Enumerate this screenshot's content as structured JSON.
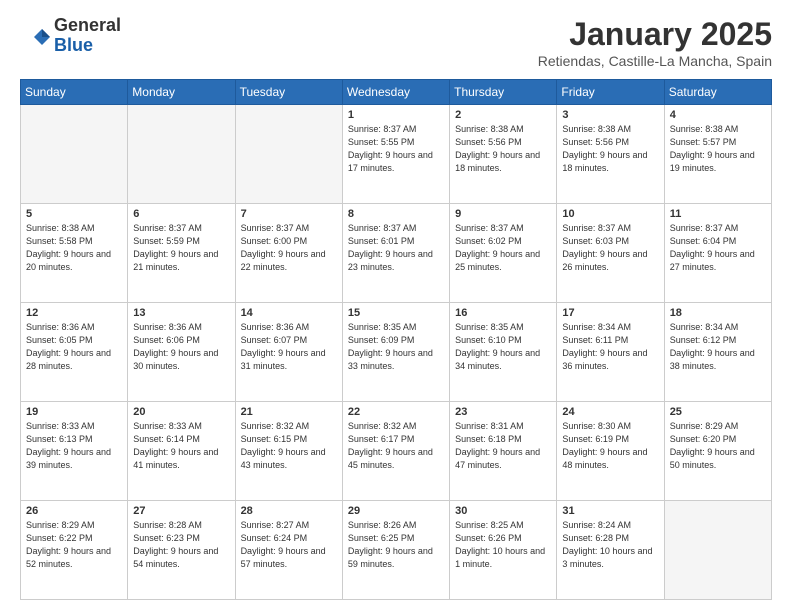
{
  "logo": {
    "general": "General",
    "blue": "Blue"
  },
  "header": {
    "month": "January 2025",
    "location": "Retiendas, Castille-La Mancha, Spain"
  },
  "weekdays": [
    "Sunday",
    "Monday",
    "Tuesday",
    "Wednesday",
    "Thursday",
    "Friday",
    "Saturday"
  ],
  "weeks": [
    [
      {
        "day": "",
        "empty": true
      },
      {
        "day": "",
        "empty": true
      },
      {
        "day": "",
        "empty": true
      },
      {
        "day": "1",
        "sunrise": "8:37 AM",
        "sunset": "5:55 PM",
        "daylight": "9 hours and 17 minutes."
      },
      {
        "day": "2",
        "sunrise": "8:38 AM",
        "sunset": "5:56 PM",
        "daylight": "9 hours and 18 minutes."
      },
      {
        "day": "3",
        "sunrise": "8:38 AM",
        "sunset": "5:56 PM",
        "daylight": "9 hours and 18 minutes."
      },
      {
        "day": "4",
        "sunrise": "8:38 AM",
        "sunset": "5:57 PM",
        "daylight": "9 hours and 19 minutes."
      }
    ],
    [
      {
        "day": "5",
        "sunrise": "8:38 AM",
        "sunset": "5:58 PM",
        "daylight": "9 hours and 20 minutes."
      },
      {
        "day": "6",
        "sunrise": "8:37 AM",
        "sunset": "5:59 PM",
        "daylight": "9 hours and 21 minutes."
      },
      {
        "day": "7",
        "sunrise": "8:37 AM",
        "sunset": "6:00 PM",
        "daylight": "9 hours and 22 minutes."
      },
      {
        "day": "8",
        "sunrise": "8:37 AM",
        "sunset": "6:01 PM",
        "daylight": "9 hours and 23 minutes."
      },
      {
        "day": "9",
        "sunrise": "8:37 AM",
        "sunset": "6:02 PM",
        "daylight": "9 hours and 25 minutes."
      },
      {
        "day": "10",
        "sunrise": "8:37 AM",
        "sunset": "6:03 PM",
        "daylight": "9 hours and 26 minutes."
      },
      {
        "day": "11",
        "sunrise": "8:37 AM",
        "sunset": "6:04 PM",
        "daylight": "9 hours and 27 minutes."
      }
    ],
    [
      {
        "day": "12",
        "sunrise": "8:36 AM",
        "sunset": "6:05 PM",
        "daylight": "9 hours and 28 minutes."
      },
      {
        "day": "13",
        "sunrise": "8:36 AM",
        "sunset": "6:06 PM",
        "daylight": "9 hours and 30 minutes."
      },
      {
        "day": "14",
        "sunrise": "8:36 AM",
        "sunset": "6:07 PM",
        "daylight": "9 hours and 31 minutes."
      },
      {
        "day": "15",
        "sunrise": "8:35 AM",
        "sunset": "6:09 PM",
        "daylight": "9 hours and 33 minutes."
      },
      {
        "day": "16",
        "sunrise": "8:35 AM",
        "sunset": "6:10 PM",
        "daylight": "9 hours and 34 minutes."
      },
      {
        "day": "17",
        "sunrise": "8:34 AM",
        "sunset": "6:11 PM",
        "daylight": "9 hours and 36 minutes."
      },
      {
        "day": "18",
        "sunrise": "8:34 AM",
        "sunset": "6:12 PM",
        "daylight": "9 hours and 38 minutes."
      }
    ],
    [
      {
        "day": "19",
        "sunrise": "8:33 AM",
        "sunset": "6:13 PM",
        "daylight": "9 hours and 39 minutes."
      },
      {
        "day": "20",
        "sunrise": "8:33 AM",
        "sunset": "6:14 PM",
        "daylight": "9 hours and 41 minutes."
      },
      {
        "day": "21",
        "sunrise": "8:32 AM",
        "sunset": "6:15 PM",
        "daylight": "9 hours and 43 minutes."
      },
      {
        "day": "22",
        "sunrise": "8:32 AM",
        "sunset": "6:17 PM",
        "daylight": "9 hours and 45 minutes."
      },
      {
        "day": "23",
        "sunrise": "8:31 AM",
        "sunset": "6:18 PM",
        "daylight": "9 hours and 47 minutes."
      },
      {
        "day": "24",
        "sunrise": "8:30 AM",
        "sunset": "6:19 PM",
        "daylight": "9 hours and 48 minutes."
      },
      {
        "day": "25",
        "sunrise": "8:29 AM",
        "sunset": "6:20 PM",
        "daylight": "9 hours and 50 minutes."
      }
    ],
    [
      {
        "day": "26",
        "sunrise": "8:29 AM",
        "sunset": "6:22 PM",
        "daylight": "9 hours and 52 minutes."
      },
      {
        "day": "27",
        "sunrise": "8:28 AM",
        "sunset": "6:23 PM",
        "daylight": "9 hours and 54 minutes."
      },
      {
        "day": "28",
        "sunrise": "8:27 AM",
        "sunset": "6:24 PM",
        "daylight": "9 hours and 57 minutes."
      },
      {
        "day": "29",
        "sunrise": "8:26 AM",
        "sunset": "6:25 PM",
        "daylight": "9 hours and 59 minutes."
      },
      {
        "day": "30",
        "sunrise": "8:25 AM",
        "sunset": "6:26 PM",
        "daylight": "10 hours and 1 minute."
      },
      {
        "day": "31",
        "sunrise": "8:24 AM",
        "sunset": "6:28 PM",
        "daylight": "10 hours and 3 minutes."
      },
      {
        "day": "",
        "empty": true
      }
    ]
  ]
}
